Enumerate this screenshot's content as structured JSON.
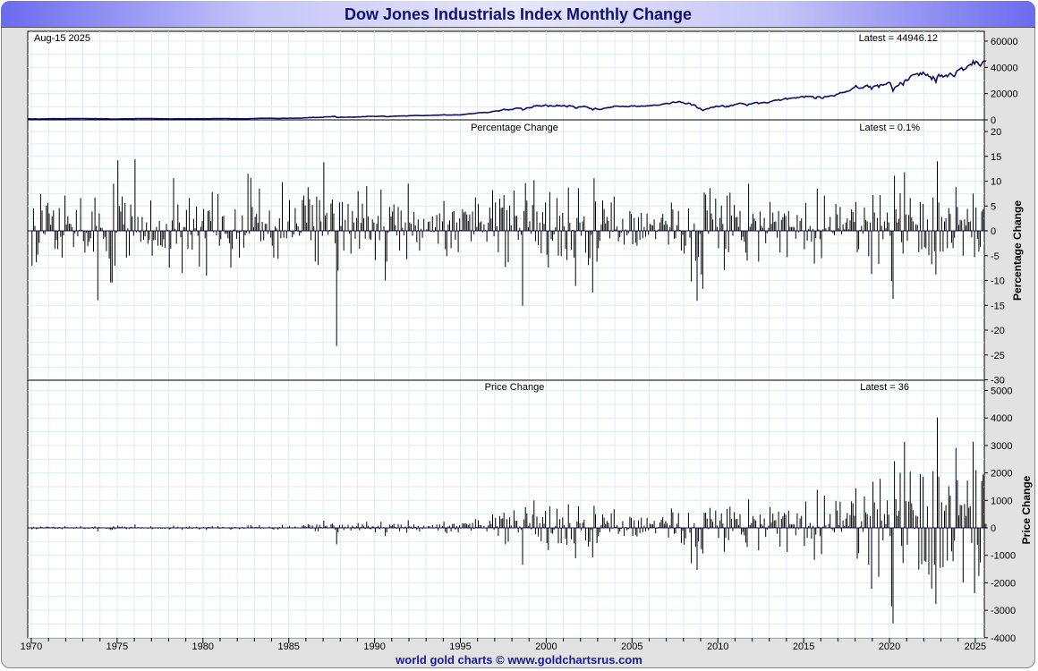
{
  "title": "Dow Jones Industrials Index Monthly Change",
  "footer": "world gold charts © www.goldchartsrus.com",
  "colors": {
    "line": "#101060",
    "bars": "#000000",
    "grid": "#dcecf6",
    "title": "#101070"
  },
  "chart_data": [
    {
      "type": "line",
      "panel": "index",
      "date_label": "Aug-15  2025",
      "latest_label": "Latest = 44946.12",
      "yticks": [
        0,
        20000,
        40000,
        60000
      ],
      "ylim": [
        0,
        60000
      ],
      "year_end_levels": {
        "1969": 800,
        "1970": 839,
        "1971": 890,
        "1972": 1020,
        "1973": 851,
        "1974": 616,
        "1975": 852,
        "1976": 1005,
        "1977": 831,
        "1978": 805,
        "1979": 839,
        "1980": 964,
        "1981": 875,
        "1982": 1047,
        "1983": 1259,
        "1984": 1212,
        "1985": 1547,
        "1986": 1896,
        "1987": 1939,
        "1988": 2169,
        "1989": 2753,
        "1990": 2634,
        "1991": 3169,
        "1992": 3301,
        "1993": 3754,
        "1994": 3834,
        "1995": 5117,
        "1996": 6448,
        "1997": 7908,
        "1998": 9181,
        "1999": 11497,
        "2000": 10787,
        "2001": 10021,
        "2002": 8342,
        "2003": 10454,
        "2004": 10783,
        "2005": 10718,
        "2006": 12463,
        "2007": 13265,
        "2008": 8776,
        "2009": 10428,
        "2010": 11578,
        "2011": 12218,
        "2012": 13104,
        "2013": 16577,
        "2014": 17823,
        "2015": 17425,
        "2016": 19763,
        "2017": 24719,
        "2018": 23327,
        "2019": 28538,
        "2020": 30606,
        "2021": 36338,
        "2022": 33147,
        "2023": 37690,
        "2024": 42544,
        "2025": 44946.12
      }
    },
    {
      "type": "bar",
      "panel": "percentage",
      "title": "Percentage Change",
      "latest_label": "Latest = 0.1%",
      "ylabel": "Percentage Change",
      "yticks": [
        20,
        15,
        10,
        5,
        0,
        -5,
        -10,
        -15,
        -20,
        -25,
        -30
      ],
      "ylim": [
        -30,
        22
      ],
      "start_year": 1970,
      "monthly_pct": {
        "1970": [
          -7.0,
          4.5,
          1.0,
          -6.3,
          -4.8,
          -2.4,
          7.4,
          4.1,
          -0.5,
          -0.7,
          5.1,
          5.6
        ],
        "1971": [
          3.5,
          1.2,
          2.9,
          4.1,
          -3.6,
          -1.8,
          -3.7,
          4.6,
          -1.2,
          -5.4,
          -0.9,
          7.1
        ],
        "1972": [
          1.3,
          2.9,
          1.4,
          1.4,
          0.7,
          -3.3,
          -0.5,
          4.2,
          -1.1,
          0.2,
          6.6,
          0.2
        ],
        "1973": [
          -2.1,
          -4.4,
          -0.4,
          -3.1,
          -2.2,
          -1.5,
          3.9,
          -4.2,
          6.7,
          1.0,
          -14.0,
          3.5
        ],
        "1974": [
          0.6,
          0.6,
          -1.6,
          -1.2,
          -4.1,
          0.0,
          -5.6,
          -10.4,
          -10.4,
          9.5,
          -7.0,
          -0.4
        ],
        "1975": [
          14.2,
          5.0,
          3.9,
          6.9,
          1.3,
          5.6,
          -5.4,
          0.5,
          -5.0,
          5.3,
          2.9,
          -1.0
        ],
        "1976": [
          14.4,
          -0.3,
          2.8,
          -0.3,
          -2.2,
          2.8,
          -1.8,
          -1.1,
          1.7,
          -2.6,
          -1.8,
          6.1
        ],
        "1977": [
          -5.0,
          -1.9,
          -1.8,
          0.8,
          -3.0,
          2.0,
          -2.9,
          -3.2,
          -1.7,
          -3.4,
          1.4,
          0.2
        ],
        "1978": [
          -7.4,
          -3.6,
          2.1,
          10.6,
          0.4,
          -2.6,
          5.3,
          1.7,
          -1.3,
          -8.5,
          0.8,
          0.7
        ],
        "1979": [
          4.2,
          -3.6,
          6.6,
          -0.8,
          -3.8,
          2.4,
          0.5,
          4.9,
          -1.0,
          -7.2,
          0.8,
          2.0
        ],
        "1980": [
          4.4,
          -1.5,
          -9.0,
          4.0,
          4.1,
          2.0,
          7.8,
          -0.3,
          0.0,
          -0.9,
          7.4,
          -3.0
        ],
        "1981": [
          -1.7,
          2.9,
          3.0,
          -0.6,
          -0.6,
          -1.5,
          -2.5,
          -7.4,
          -3.6,
          0.3,
          4.3,
          -1.6
        ],
        "1982": [
          -0.4,
          -5.4,
          -0.2,
          3.1,
          -3.4,
          -0.9,
          -0.4,
          11.5,
          -0.6,
          10.7,
          4.8,
          0.7
        ],
        "1983": [
          2.8,
          3.4,
          1.6,
          8.5,
          -2.1,
          1.8,
          -1.9,
          1.4,
          1.4,
          -0.6,
          4.1,
          -1.4
        ],
        "1984": [
          -3.0,
          -5.4,
          0.9,
          0.5,
          -5.6,
          2.5,
          -1.5,
          9.8,
          -1.4,
          0.1,
          -1.5,
          1.9
        ],
        "1985": [
          6.2,
          -0.2,
          -1.3,
          -0.7,
          4.6,
          1.5,
          0.9,
          -1.0,
          -0.4,
          6.2,
          7.1,
          5.1
        ],
        "1986": [
          1.6,
          8.8,
          6.4,
          -1.9,
          5.2,
          0.9,
          -6.2,
          6.9,
          -6.9,
          6.2,
          1.9,
          -1.0
        ],
        "1987": [
          13.8,
          3.1,
          3.6,
          -0.8,
          0.2,
          5.5,
          6.3,
          3.5,
          -2.5,
          -23.2,
          -8.0,
          5.7
        ],
        "1988": [
          1.0,
          5.8,
          -4.0,
          2.2,
          -0.1,
          5.4,
          -0.6,
          -4.6,
          4.0,
          1.7,
          -1.6,
          2.6
        ],
        "1989": [
          8.0,
          -3.6,
          1.6,
          5.5,
          2.5,
          -1.6,
          9.0,
          2.9,
          -1.6,
          -1.8,
          2.3,
          1.7
        ],
        "1990": [
          -5.9,
          1.4,
          3.0,
          -1.9,
          8.3,
          0.1,
          0.9,
          -10.0,
          -6.2,
          -0.4,
          4.8,
          2.9
        ],
        "1991": [
          3.9,
          5.3,
          1.1,
          -0.9,
          4.8,
          -4.0,
          4.1,
          0.6,
          -0.9,
          1.7,
          -5.7,
          9.5
        ],
        "1992": [
          1.7,
          1.4,
          -1.0,
          3.8,
          1.1,
          -2.3,
          2.3,
          -4.0,
          0.4,
          -1.4,
          2.4,
          -0.1
        ],
        "1993": [
          0.3,
          1.8,
          1.9,
          -0.2,
          2.9,
          -0.3,
          0.7,
          3.2,
          -2.6,
          3.5,
          0.1,
          1.9
        ],
        "1994": [
          6.0,
          -3.7,
          -5.1,
          1.3,
          2.1,
          -3.5,
          3.8,
          4.0,
          -1.8,
          1.7,
          -4.3,
          2.5
        ],
        "1995": [
          0.2,
          4.3,
          3.7,
          3.9,
          3.3,
          2.0,
          3.3,
          -2.1,
          3.9,
          -0.7,
          6.7,
          0.8
        ],
        "1996": [
          5.4,
          1.7,
          1.9,
          -0.3,
          1.3,
          0.2,
          -2.2,
          1.6,
          4.7,
          2.5,
          8.2,
          -1.1
        ],
        "1997": [
          5.7,
          0.9,
          -4.3,
          6.5,
          4.6,
          4.7,
          7.2,
          -7.3,
          4.2,
          -6.3,
          5.1,
          1.1
        ],
        "1998": [
          0.0,
          8.1,
          3.0,
          3.0,
          -1.8,
          0.6,
          -0.8,
          -15.1,
          4.0,
          9.6,
          6.1,
          0.7
        ],
        "1999": [
          1.9,
          -0.6,
          5.2,
          10.2,
          -2.1,
          3.9,
          -2.9,
          1.6,
          -4.5,
          3.8,
          1.4,
          5.7
        ],
        "2000": [
          -4.8,
          -7.4,
          7.8,
          -1.7,
          -2.0,
          -0.7,
          0.7,
          6.6,
          -5.0,
          3.0,
          -5.1,
          3.6
        ],
        "2001": [
          0.9,
          -3.6,
          -5.9,
          8.7,
          1.6,
          -3.8,
          0.2,
          -5.4,
          -11.1,
          2.6,
          8.6,
          1.7
        ],
        "2002": [
          -1.0,
          1.9,
          2.9,
          -4.4,
          -0.2,
          -6.9,
          -5.5,
          -0.8,
          -12.4,
          10.6,
          5.9,
          -6.2
        ],
        "2003": [
          -3.5,
          -2.0,
          1.3,
          6.1,
          4.4,
          1.5,
          2.8,
          2.0,
          -1.5,
          5.7,
          -0.2,
          6.9
        ],
        "2004": [
          0.3,
          0.9,
          -2.1,
          -1.3,
          -0.4,
          2.4,
          -2.8,
          0.3,
          -0.9,
          -0.5,
          4.0,
          3.4
        ],
        "2005": [
          -2.7,
          2.6,
          -2.4,
          -3.0,
          2.7,
          -1.8,
          3.6,
          -1.5,
          0.8,
          -1.2,
          3.5,
          -0.8
        ],
        "2006": [
          1.4,
          1.2,
          1.1,
          2.3,
          -1.7,
          -0.2,
          0.3,
          1.7,
          2.6,
          3.4,
          1.2,
          2.0
        ],
        "2007": [
          1.3,
          -2.8,
          0.7,
          5.7,
          4.3,
          -1.6,
          -1.5,
          1.1,
          4.0,
          0.2,
          -4.0,
          -0.8
        ],
        "2008": [
          -4.6,
          -3.0,
          0.0,
          4.5,
          -1.4,
          -10.2,
          0.2,
          1.5,
          -6.0,
          -14.1,
          -5.3,
          -0.6
        ],
        "2009": [
          -8.8,
          -11.7,
          7.7,
          7.3,
          4.1,
          -0.6,
          8.6,
          3.5,
          2.3,
          0.0,
          6.5,
          0.8
        ],
        "2010": [
          -3.5,
          2.6,
          5.1,
          1.4,
          -7.9,
          -3.6,
          7.1,
          -4.3,
          7.7,
          3.1,
          -1.0,
          5.2
        ],
        "2011": [
          2.7,
          2.8,
          0.8,
          4.0,
          -1.9,
          -1.2,
          -2.2,
          -4.4,
          -6.0,
          9.5,
          0.8,
          1.4
        ],
        "2012": [
          3.4,
          2.5,
          2.0,
          0.0,
          -6.2,
          3.9,
          1.0,
          0.6,
          2.6,
          -2.5,
          -0.5,
          0.6
        ],
        "2013": [
          5.8,
          1.4,
          3.7,
          1.8,
          1.9,
          -1.4,
          4.0,
          -4.4,
          2.2,
          2.8,
          3.5,
          3.0
        ],
        "2014": [
          -5.3,
          4.0,
          0.8,
          0.7,
          0.8,
          0.7,
          -1.6,
          3.2,
          -0.3,
          2.0,
          2.5,
          0.0
        ],
        "2015": [
          -3.7,
          5.6,
          -2.0,
          0.4,
          1.0,
          -2.2,
          0.4,
          -6.6,
          -1.5,
          8.5,
          0.3,
          -1.7
        ],
        "2016": [
          -5.5,
          0.3,
          7.1,
          0.5,
          0.1,
          0.8,
          2.8,
          -0.2,
          -0.5,
          -0.9,
          5.4,
          3.3
        ],
        "2017": [
          0.5,
          4.8,
          -0.7,
          1.3,
          0.3,
          1.6,
          2.5,
          0.3,
          2.1,
          4.3,
          3.8,
          1.8
        ],
        "2018": [
          5.8,
          -4.3,
          -3.7,
          0.2,
          1.0,
          -0.6,
          4.7,
          2.2,
          1.9,
          -5.1,
          1.7,
          -8.7
        ],
        "2019": [
          7.2,
          3.7,
          0.0,
          2.6,
          -6.7,
          7.2,
          1.0,
          -1.7,
          1.9,
          0.5,
          3.7,
          1.7
        ],
        "2020": [
          -1.0,
          -10.1,
          -13.7,
          11.1,
          4.3,
          1.7,
          2.4,
          7.6,
          -2.3,
          -4.6,
          11.8,
          3.3
        ],
        "2021": [
          -2.0,
          3.2,
          6.6,
          2.7,
          1.9,
          -0.1,
          1.3,
          1.2,
          -4.3,
          5.8,
          -3.7,
          5.4
        ],
        "2022": [
          -3.3,
          -3.5,
          2.3,
          -4.9,
          0.0,
          -6.7,
          6.7,
          -4.1,
          -8.8,
          14.0,
          5.7,
          -4.2
        ],
        "2023": [
          2.8,
          -4.2,
          1.9,
          2.5,
          -3.5,
          4.6,
          3.4,
          -2.4,
          -3.5,
          -1.4,
          8.8,
          4.8
        ],
        "2024": [
          1.2,
          2.2,
          2.1,
          -5.0,
          2.3,
          1.1,
          4.4,
          1.8,
          1.9,
          -1.3,
          7.5,
          -5.3
        ],
        "2025": [
          4.7,
          -1.6,
          -4.2,
          -3.2,
          3.9,
          4.3,
          0.1,
          0.1
        ]
      }
    },
    {
      "type": "bar",
      "panel": "price",
      "title": "Price Change",
      "latest_label": "Latest = 36",
      "ylabel": "Price Change",
      "yticks": [
        5000,
        4000,
        3000,
        2000,
        1000,
        0,
        -1000,
        -2000,
        -3000,
        -4000
      ],
      "ylim": [
        -4000,
        5400
      ]
    }
  ],
  "xaxis": {
    "ticks": [
      "1970",
      "1975",
      "1980",
      "1985",
      "1990",
      "1995",
      "2000",
      "2005",
      "2010",
      "2015",
      "2020",
      "2025"
    ],
    "range": [
      1970,
      2025.7
    ]
  }
}
